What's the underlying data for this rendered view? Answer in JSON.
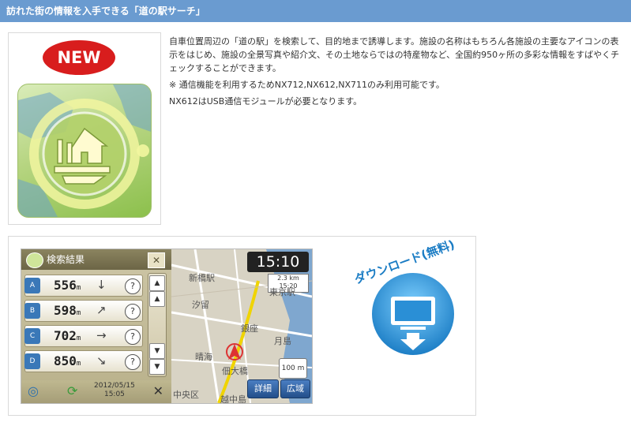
{
  "header": {
    "title": "訪れた街の情報を入手できる「道の駅サーチ」"
  },
  "badge": {
    "label": "NEW"
  },
  "description": {
    "main": "自車位置周辺の「道の駅」を検索して、目的地まで誘導します。施設の名称はもちろん各施設の主要なアイコンの表示をはじめ、施設の全景写真や紹介文、その土地ならではの特産物など、全国約950ヶ所の多彩な情報をすばやくチェックすることができます。",
    "note1": "※ 通信機能を利用するためNX712,NX612,NX711のみ利用可能です。",
    "note2": "NX612はUSB通信モジュールが必要となります。"
  },
  "screenshot": {
    "list_title": "検索結果",
    "rows": [
      {
        "mark": "A",
        "distance": "556",
        "unit": "m",
        "direction": "↓"
      },
      {
        "mark": "B",
        "distance": "598",
        "unit": "m",
        "direction": "↗"
      },
      {
        "mark": "C",
        "distance": "702",
        "unit": "m",
        "direction": "→"
      },
      {
        "mark": "D",
        "distance": "850",
        "unit": "m",
        "direction": "↘"
      }
    ],
    "info_label": "?",
    "date": "2012/05/15",
    "clock": "15:05",
    "map": {
      "time": "15:10",
      "distance": "2.3 km",
      "eta": "15:20",
      "places": [
        "新橋駅",
        "東京駅",
        "汐留",
        "銀座",
        "晴海",
        "中央区",
        "月島",
        "佃大橋",
        "越中島"
      ],
      "scale": "100 m",
      "detail_button": "詳細",
      "wide_button": "広域"
    }
  },
  "download": {
    "label": "ダウンロード(無料)"
  },
  "colors": {
    "header_bg": "#6a9bd0",
    "badge_red": "#d81d1d",
    "icon_green": "#8cc04c",
    "download_blue": "#2a8fd6"
  }
}
